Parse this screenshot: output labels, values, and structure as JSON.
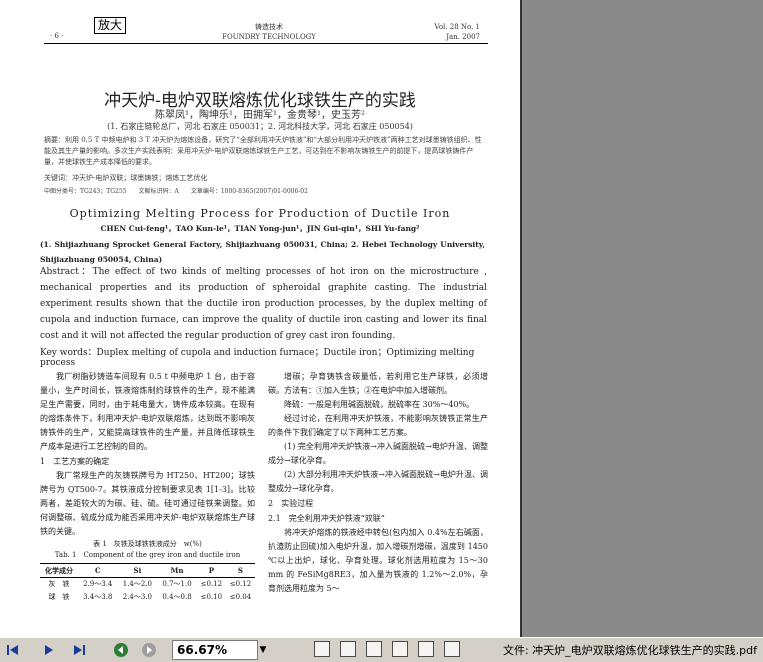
{
  "zoom_button": "放大",
  "header": {
    "page_no": "· 6 ·",
    "journal_cn": "铸造技术",
    "journal_en": "FOUNDRY TECHNOLOGY",
    "volume": "Vol. 28 No. 1",
    "date": "Jan. 2007"
  },
  "paper": {
    "title_cn": "冲天炉-电炉双联熔炼优化球铁生产的实践",
    "authors_cn": "陈翠凤¹，陶坤乐¹，田拥军¹，金贵琴¹，史玉芳²",
    "affiliation_cn": "(1. 石家庄链轮总厂，河北 石家庄 050031；2. 河北科技大学，河北 石家庄 050054)",
    "abstract_cn": "摘要：利用 0.5 T 中频电炉和 3 T 冲天炉为熔炼设备，研究了“全部利用冲天炉铁液”和“大部分利用冲天炉铁液”两种工艺对球墨铸铁组织、性能及其生产量的影响。多次生产实践表明：采用冲天炉-电炉双联熔炼球铁生产工艺，可达到在不影响灰铸铁生产的前提下，提高球铁铸件产量，并使球铁生产成本降低的要求。",
    "keywords_cn": "关键词：冲天炉-电炉双联；球墨铸铁；熔炼工艺优化",
    "classification": "中图分类号：TG243；TG255　　文献标识码：A　　文章编号：1000-8365(2007)01-0006-02",
    "title_en": "Optimizing Melting Process for Production of Ductile Iron",
    "authors_en": "CHEN Cui-feng¹，TAO Kun-le¹，TIAN Yong-jun¹，JIN Gui-qin¹，SHI Yu-fang²",
    "affiliation_en": "(1. Shijiazhuang Sprocket General Factory, Shijiazhuang 050031, China; 2. Hebei Technology University, Shijiazhuang 050054, China)",
    "abstract_en": "Abstract：The effect of two kinds of melting processes of hot iron on the microstructure , mechanical properties and its production of spheroidal graphite casting. The industrial experiment results shown that the ductile iron production processes, by the duplex melting of cupola and induction furnace, can improve the quality of ductile iron casting and lower its final cost and it will not affected the regular production of grey cast iron founding.",
    "keywords_en": "Key words：Duplex melting of cupola and induction furnace；Ductile iron；Optimizing melting process"
  },
  "body_left": {
    "p1": "我厂树脂砂铸造车间现有 0.5 t 中频电炉 1 台，由于容量小，生产时间长，铁液熔炼制约球铁件的生产，现不能满足生产需要，同时，由于耗电量大，铸件成本较高。在现有的熔炼条件下，利用冲天炉-电炉双联熔炼，达到既不影响灰铸铁件的生产，又能提高球铁件的生产量，并且降低球铁生产成本是进行工艺控制的目的。",
    "sec1": "1　工艺方案的确定",
    "p2": "我厂常规生产的灰铸铁牌号为 HT250、HT200；球铁牌号为 QT500-7。其铁液成分控制要求见表 1[1-3]。比较两者，差距较大的为碳、硅、硫。硅可通过硅铁来调整。如何调整碳、硫成分成为能否采用冲天炉-电炉双联熔炼生产球铁的关键。",
    "table_caption_cn": "表 1　灰铁及球铁铁液成分　w(%)",
    "table_caption_en": "Tab. 1　Component of the grey iron and ductile iron",
    "table_headers": [
      "化学成分",
      "C",
      "Si",
      "Mn",
      "P",
      "S"
    ],
    "table_rows": [
      [
        "灰　铁",
        "2.9～3.4",
        "1.4～2.0",
        "0.7～1.0",
        "≤0.12",
        "≤0.12"
      ],
      [
        "球　铁",
        "3.4～3.8",
        "2.4～3.0",
        "0.4～0.8",
        "≤0.10",
        "≤0.04"
      ]
    ]
  },
  "body_right": {
    "p1": "增碳；孕育铸铁含碳量低，若利用它生产球铁，必须增碳。方法有：①加入生铁；②在电炉中加入增碳剂。",
    "p2": "降硫：一般是利用碱面脱硫，脱硫率在 30%～40%。",
    "p3": "经过讨论，在利用冲天炉铁液，不能影响灰铸铁正常生产的条件下我们确定了以下两种工艺方案。",
    "p4": "(1) 完全利用冲天炉铁液→冲入碱面脱硫→电炉升温、调整成分→球化孕育。",
    "p5": "(2) 大部分利用冲天炉铁液→冲入碱面脱硫→电炉升温、调整成分→球化孕育。",
    "sec2": "2　实验过程",
    "sec21": "2.1　完全利用冲天炉铁液“双联”",
    "p6": "将冲天炉熔炼的铁液经中转包(包内加入 0.4%左右碱面，扒渣防止回硫)加入电炉升温，加入增碳剂增碳，温度到 1450 ℃以上出炉，球化、孕育处理。球化剂选用粒度为 15～30 mm 的 FeSiMg8RE3，加入量为铁液的 1.2%～2.0%，孕育剂选用粒度为 5～"
  },
  "toolbar": {
    "zoom_value": "66.67%",
    "filename": "文件: 冲天炉_电炉双联熔炼优化球铁生产的实践.pdf"
  }
}
